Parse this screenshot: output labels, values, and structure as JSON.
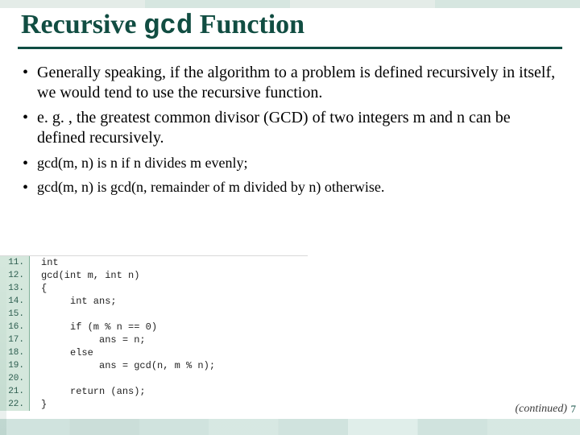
{
  "title": {
    "part1": "Recursive ",
    "code": "gcd",
    "part2": " Function"
  },
  "bullets": [
    "Generally speaking, if the algorithm to a problem is defined recursively in itself, we would tend to use the recursive function.",
    "e. g. , the greatest common divisor (GCD) of two integers m and n can be defined recursively."
  ],
  "subbullets": [
    "gcd(m, n) is n if n divides m evenly;",
    "gcd(m, n) is gcd(n, remainder of m divided by n) otherwise."
  ],
  "code": [
    {
      "ln": "11.",
      "src": "int"
    },
    {
      "ln": "12.",
      "src": "gcd(int m, int n)"
    },
    {
      "ln": "13.",
      "src": "{"
    },
    {
      "ln": "14.",
      "src": "     int ans;"
    },
    {
      "ln": "15.",
      "src": ""
    },
    {
      "ln": "16.",
      "src": "     if (m % n == 0)"
    },
    {
      "ln": "17.",
      "src": "          ans = n;"
    },
    {
      "ln": "18.",
      "src": "     else"
    },
    {
      "ln": "19.",
      "src": "          ans = gcd(n, m % n);"
    },
    {
      "ln": "20.",
      "src": ""
    },
    {
      "ln": "21.",
      "src": "     return (ans);"
    },
    {
      "ln": "22.",
      "src": "}"
    }
  ],
  "footer": {
    "continued": "(continued)",
    "page": "7"
  }
}
